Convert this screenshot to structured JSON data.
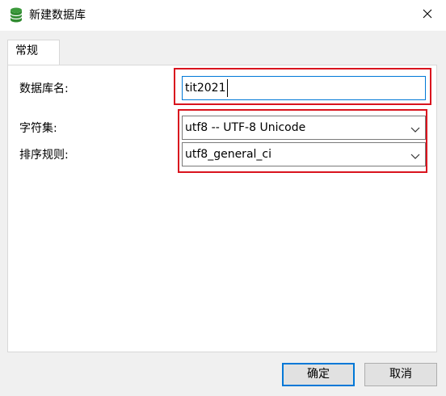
{
  "window": {
    "title": "新建数据库",
    "app_icon": "database-icon",
    "close_icon": "close-icon"
  },
  "tabs": [
    {
      "label": "常规",
      "selected": true
    }
  ],
  "form": {
    "db_name_label": "数据库名:",
    "db_name_value": "tit2021",
    "charset_label": "字符集:",
    "charset_value": "utf8 -- UTF-8 Unicode",
    "collation_label": "排序规则:",
    "collation_value": "utf8_general_ci"
  },
  "buttons": {
    "ok": "确定",
    "cancel": "取消"
  },
  "colors": {
    "highlight": "#d9141e",
    "focus_border": "#0078d7",
    "icon_green": "#3c9a3c"
  }
}
